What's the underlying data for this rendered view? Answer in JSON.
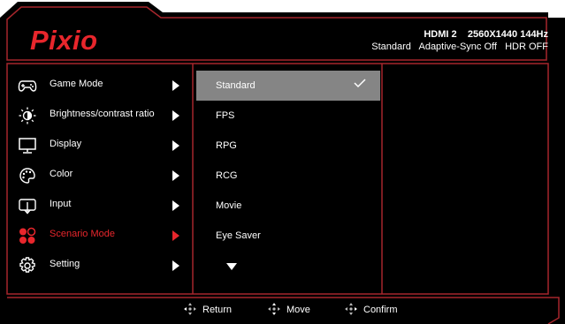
{
  "brand": {
    "logo_text": "Pixio"
  },
  "status": {
    "input": "HDMI 2",
    "resolution": "2560X1440",
    "refresh": "144Hz",
    "preset": "Standard",
    "adaptive_sync": "Adaptive-Sync Off",
    "hdr": "HDR OFF"
  },
  "menu": {
    "items": [
      {
        "label": "Game Mode",
        "icon": "gamepad-icon"
      },
      {
        "label": "Brightness/contrast ratio",
        "icon": "brightness-icon"
      },
      {
        "label": "Display",
        "icon": "monitor-icon"
      },
      {
        "label": "Color",
        "icon": "palette-icon"
      },
      {
        "label": "Input",
        "icon": "input-icon"
      },
      {
        "label": "Scenario Mode",
        "icon": "scenario-icon",
        "active": true
      },
      {
        "label": "Setting",
        "icon": "gear-icon"
      }
    ]
  },
  "submenu": {
    "items": [
      {
        "label": "Standard",
        "selected": true
      },
      {
        "label": "FPS"
      },
      {
        "label": "RPG"
      },
      {
        "label": "RCG"
      },
      {
        "label": "Movie"
      },
      {
        "label": "Eye Saver"
      }
    ]
  },
  "footer": {
    "return_label": "Return",
    "move_label": "Move",
    "confirm_label": "Confirm"
  },
  "colors": {
    "accent": "#e8262c",
    "background": "#000000",
    "border": "#a6262c",
    "selection": "#858585"
  }
}
